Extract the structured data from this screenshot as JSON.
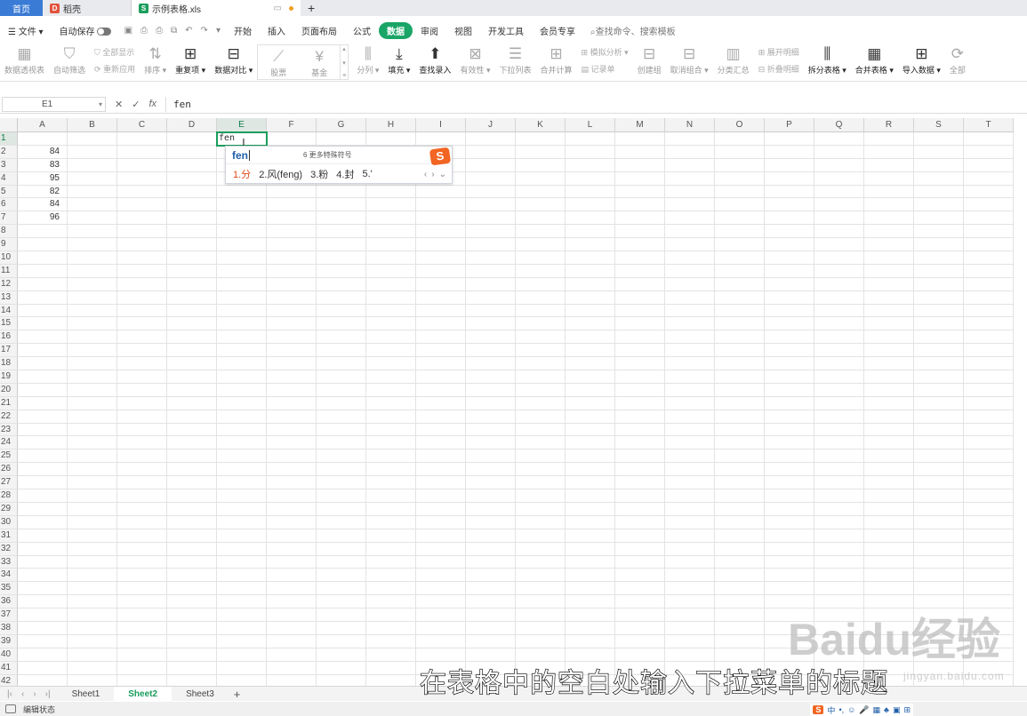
{
  "tabs": {
    "home": "首页",
    "doc": "稻壳",
    "file": "示例表格.xls"
  },
  "menubar": {
    "file": "文件",
    "autosave": "自动保存",
    "items": [
      "开始",
      "插入",
      "页面布局",
      "公式",
      "数据",
      "审阅",
      "视图",
      "开发工具",
      "会员专享"
    ],
    "active": "数据",
    "search": "查找命令、搜索模板"
  },
  "ribbon": {
    "pivot": "数据透视表",
    "autofilter": "自动筛选",
    "showall": "全部显示",
    "reapply": "重新应用",
    "sort": "排序",
    "dup": "重复项",
    "compare": "数据对比",
    "stock": "股票",
    "fund": "基金",
    "split": "分列",
    "fill": "填充",
    "lookup": "查找录入",
    "validity": "有效性",
    "dropdown": "下拉列表",
    "consolidate": "合并计算",
    "simulate": "模拟分析",
    "record": "记录单",
    "group": "创建组",
    "ungroup": "取消组合",
    "subtotal": "分类汇总",
    "expand": "展开明细",
    "collapse": "折叠明细",
    "splittable": "拆分表格",
    "mergetable": "合并表格",
    "import": "导入数据",
    "more": "全部"
  },
  "formula_bar": {
    "cell_ref": "E1",
    "content": "fen"
  },
  "grid": {
    "columns": [
      "A",
      "B",
      "C",
      "D",
      "E",
      "F",
      "G",
      "H",
      "I",
      "J",
      "K",
      "L",
      "M",
      "N",
      "O",
      "P",
      "Q",
      "R",
      "S",
      "T"
    ],
    "selected_col": "E",
    "selected_row": "1",
    "rows": [
      "1",
      "2",
      "3",
      "4",
      "5",
      "6",
      "7",
      "8",
      "9",
      "10",
      "11",
      "12",
      "13",
      "14",
      "15",
      "16",
      "17",
      "18",
      "19",
      "20",
      "21",
      "22",
      "23",
      "24",
      "25",
      "26",
      "27",
      "28",
      "29",
      "30",
      "31",
      "32",
      "33",
      "34",
      "35",
      "36",
      "37",
      "38",
      "39",
      "40",
      "41",
      "42"
    ],
    "col_a": [
      "",
      "84",
      "83",
      "95",
      "82",
      "84",
      "96"
    ],
    "active_cell_text": "fen"
  },
  "ime": {
    "pinyin": "fen",
    "more_symbols": "6 更多特殊符号",
    "candidates": [
      "1.分",
      "2.风(feng)",
      "3.粉",
      "4.封",
      "5.'"
    ],
    "logo": "S"
  },
  "sheets": {
    "tabs": [
      "Sheet1",
      "Sheet2",
      "Sheet3"
    ],
    "active": "Sheet2"
  },
  "status": {
    "mode": "编辑状态",
    "tray_lang": "中"
  },
  "overlay": {
    "subtitle": "在表格中的空白处输入下拉菜单的标题",
    "watermark": "Baidu经验",
    "watermark_url": "jingyan.baidu.com"
  }
}
